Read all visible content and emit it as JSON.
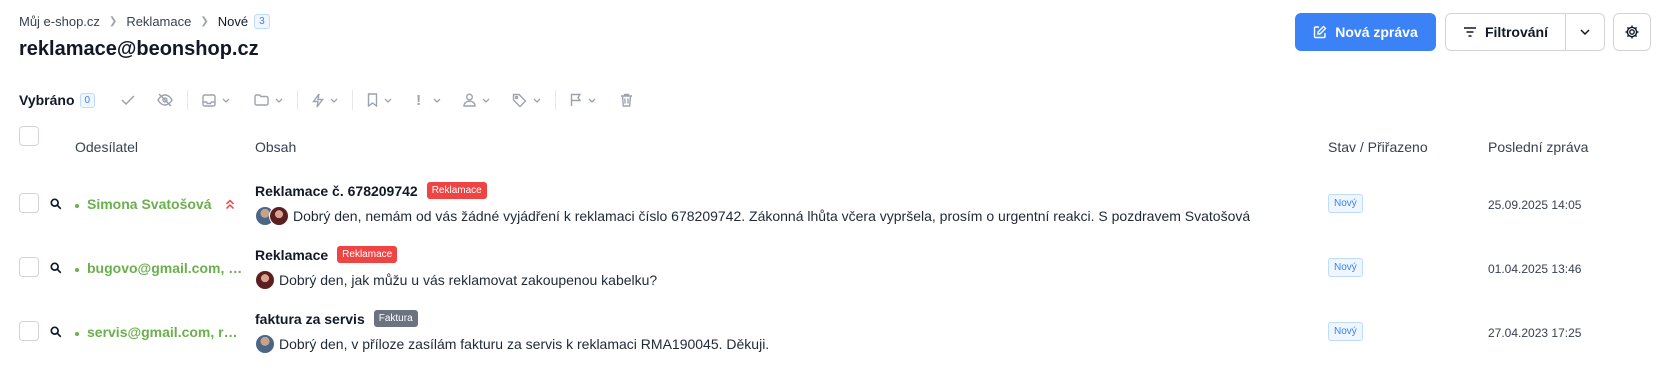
{
  "breadcrumb": {
    "items": [
      "Můj e-shop.cz",
      "Reklamace",
      "Nové"
    ],
    "count": "3"
  },
  "page_title": "reklamace@beonshop.cz",
  "header_actions": {
    "new_message_label": "Nová zpráva",
    "filter_label": "Filtrování"
  },
  "toolbar": {
    "selected_label": "Vybráno",
    "selected_count": "0"
  },
  "table": {
    "columns": {
      "sender": "Odesílatel",
      "content": "Obsah",
      "state": "Stav / Přiřazeno",
      "last": "Poslední zpráva"
    },
    "rows": [
      {
        "sender": "Simona Svatošová",
        "subject": "Reklamace č. 678209742",
        "tag": "Reklamace",
        "tag_color": "#ef4444",
        "preview": "Dobrý den, nemám od vás žádné vyjádření k reklamaci číslo 678209742. Zákonná lhůta včera vypršela, prosím o urgentní reakci. S pozdravem Svatošová",
        "state": "Nový",
        "date": "25.09.2025 14:05"
      },
      {
        "sender": "bugovo@gmail.com, …",
        "subject": "Reklamace",
        "tag": "Reklamace",
        "tag_color": "#ef4444",
        "preview": "Dobrý den, jak můžu u vás reklamovat zakoupenou kabelku?",
        "state": "Nový",
        "date": "01.04.2025 13:46"
      },
      {
        "sender": "servis@gmail.com, r…",
        "subject": "faktura za servis",
        "tag": "Faktura",
        "tag_color": "#6b7280",
        "preview": "Dobrý den, v příloze zasílám fakturu za servis k reklamaci RMA190045. Děkuji.",
        "state": "Nový",
        "date": "27.04.2023 17:25"
      }
    ]
  },
  "colors": {
    "accent": "#3b82f6",
    "sender_green": "#6ab04c",
    "danger": "#ef4444"
  }
}
